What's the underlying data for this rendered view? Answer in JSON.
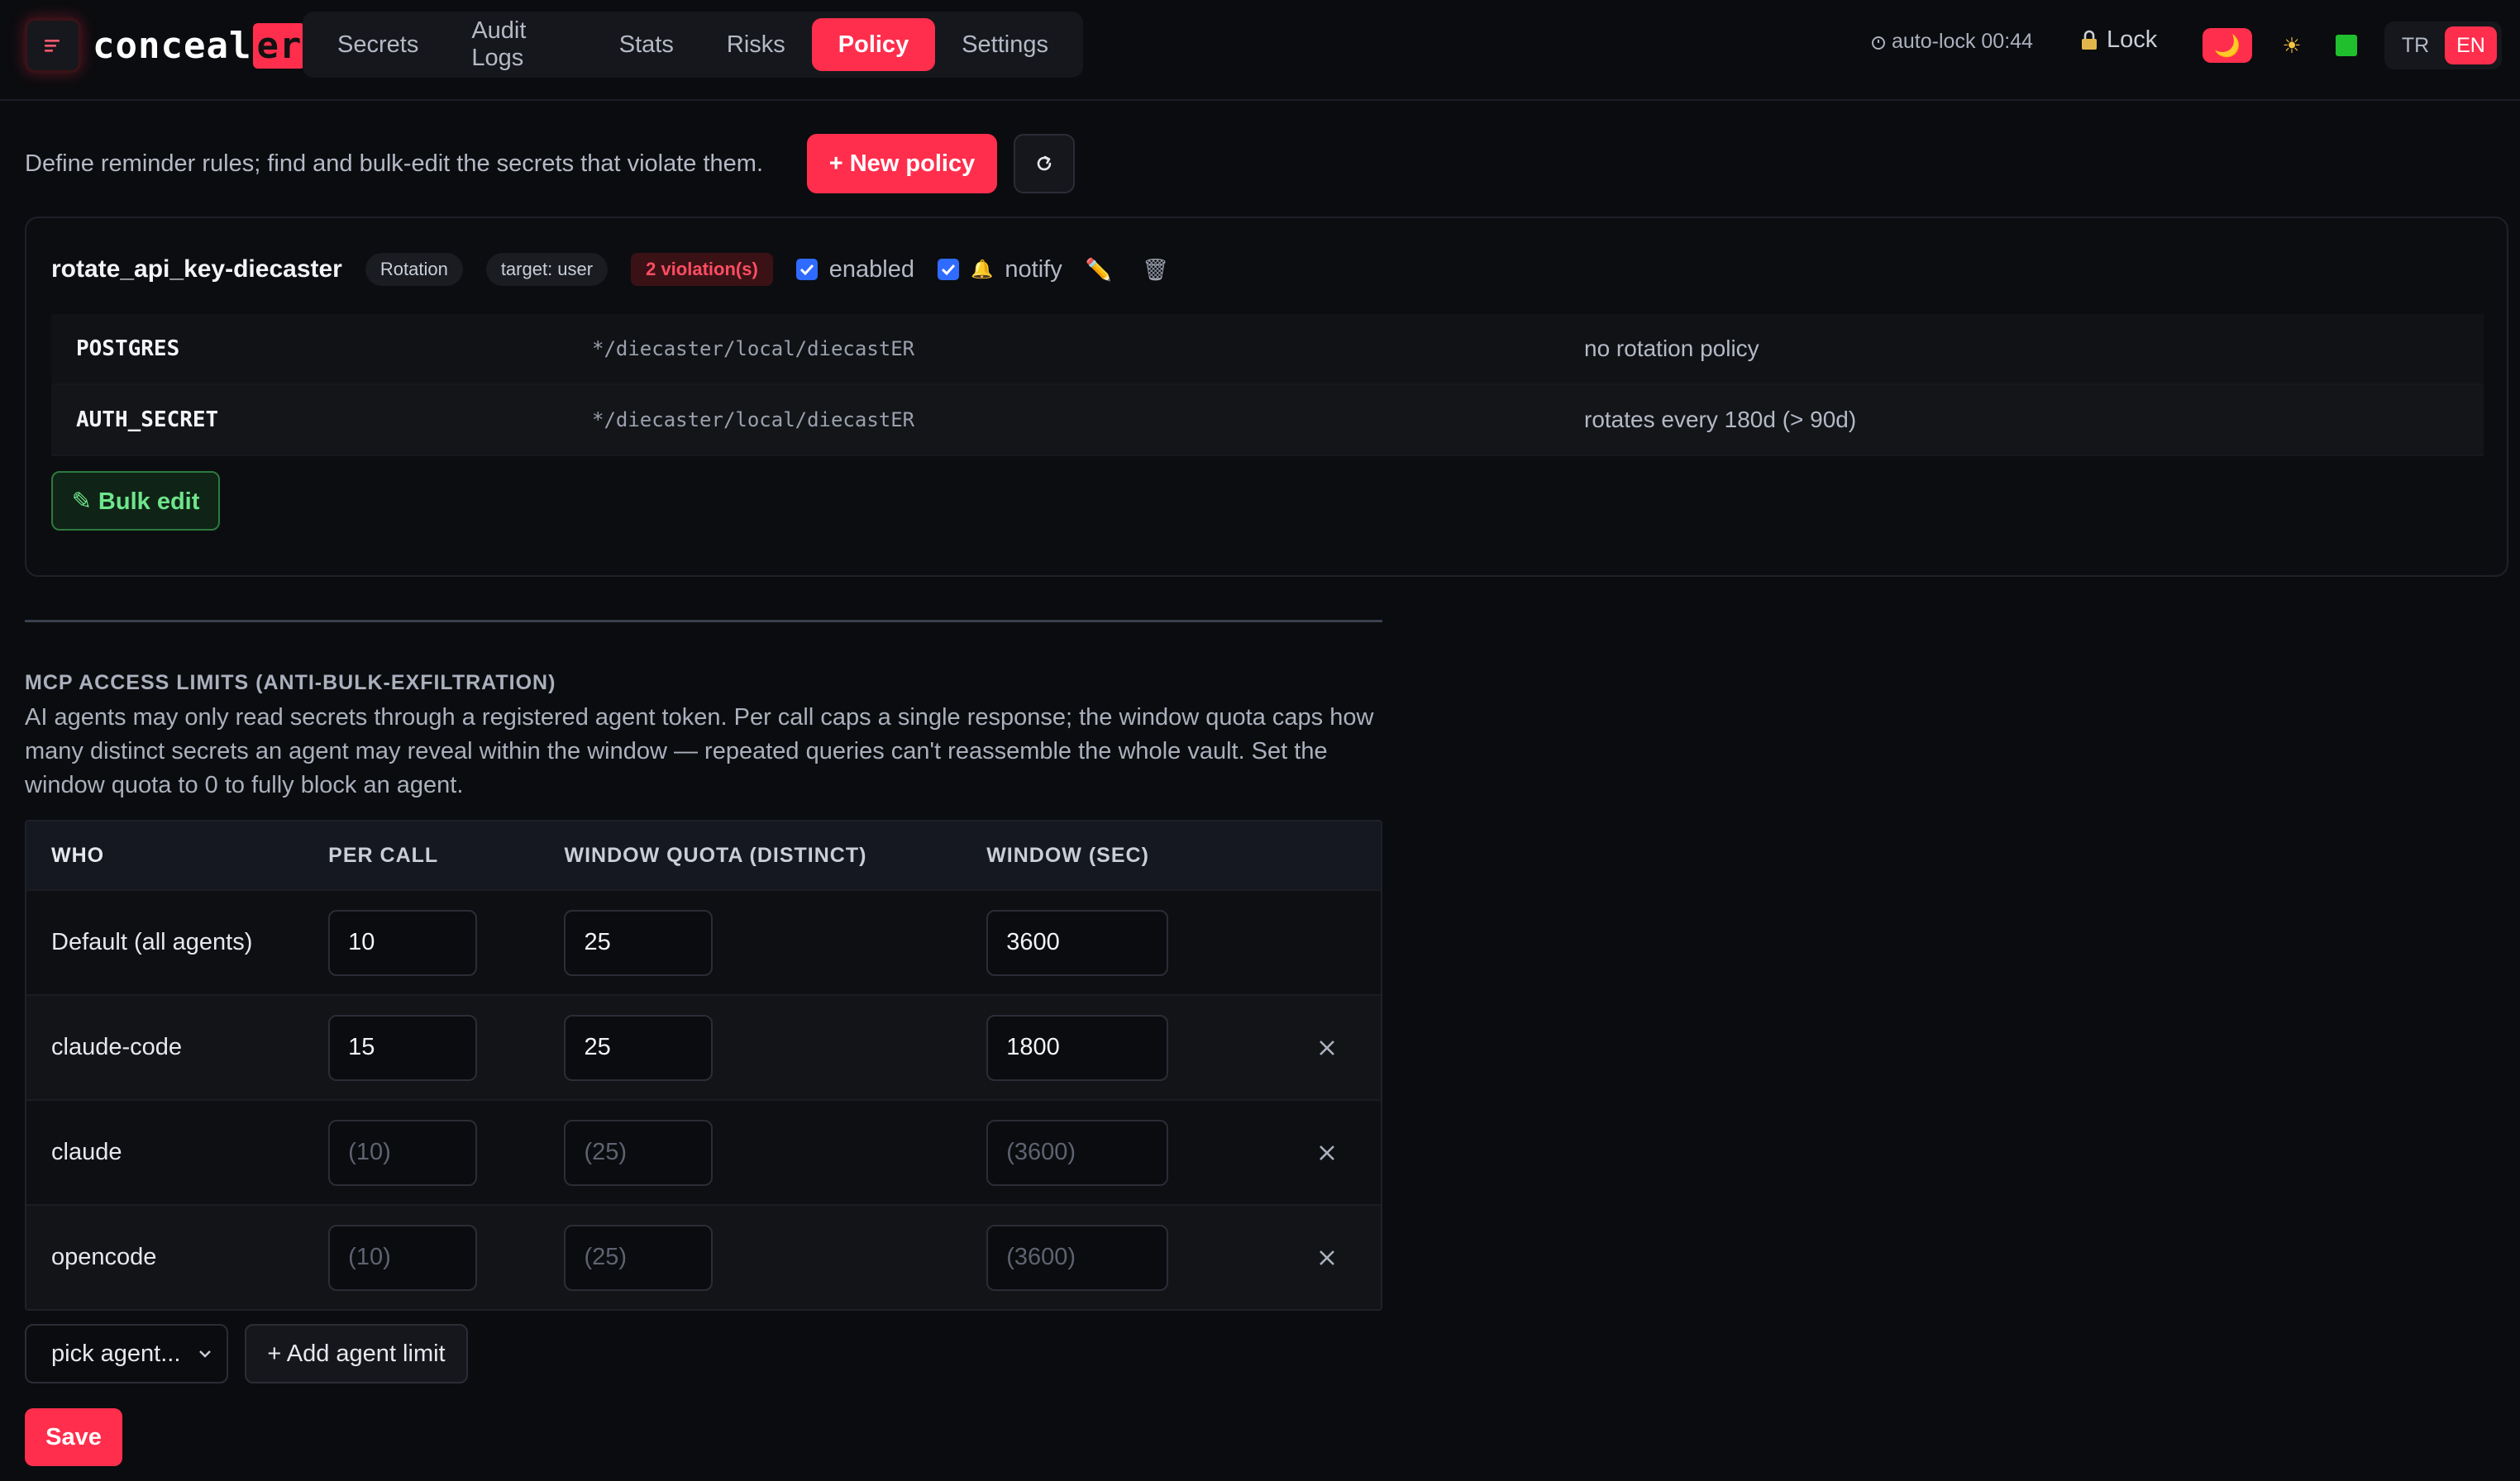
{
  "app": {
    "logo_prefix": "conceal",
    "logo_highlight": "er"
  },
  "nav": {
    "tabs": [
      "Secrets",
      "Audit Logs",
      "Stats",
      "Risks",
      "Policy",
      "Settings"
    ],
    "active": "Policy"
  },
  "header": {
    "autolock": "auto-lock 00:44",
    "lock_label": "Lock",
    "lang_tr": "TR",
    "lang_en": "EN",
    "active_lang": "EN",
    "theme_moon": "🌙",
    "theme_sun": "☀"
  },
  "intro": {
    "text": "Define reminder rules; find and bulk-edit the secrets that violate them.",
    "new_policy_label": "+ New policy"
  },
  "policy": {
    "name": "rotate_api_key-diecaster",
    "type_chip": "Rotation",
    "target_chip": "target: user",
    "violations_chip": "2 violation(s)",
    "enabled_label": "enabled",
    "notify_label": "notify",
    "bell": "🔔",
    "edit_icon": "✏️",
    "delete_icon": "🗑",
    "rows": [
      {
        "name": "POSTGRES",
        "path": "*/diecaster/local/diecastER",
        "reason": "no rotation policy"
      },
      {
        "name": "AUTH_SECRET",
        "path": "*/diecaster/local/diecastER",
        "reason": "rotates every 180d (> 90d)"
      }
    ],
    "bulk_edit_label": "✎ Bulk edit"
  },
  "mcp": {
    "title": "MCP ACCESS LIMITS (ANTI-BULK-EXFILTRATION)",
    "description": "AI agents may only read secrets through a registered agent token. Per call caps a single response; the window quota caps how many distinct secrets an agent may reveal within the window — repeated queries can't reassemble the whole vault. Set the window quota to 0 to fully block an agent.",
    "columns": {
      "who": "WHO",
      "per_call": "PER CALL",
      "window_quota": "WINDOW QUOTA (DISTINCT)",
      "window_sec": "WINDOW (SEC)"
    },
    "rows": [
      {
        "who": "Default (all agents)",
        "per_call": "10",
        "per_call_ph": "",
        "quota": "25",
        "quota_ph": "",
        "sec": "3600",
        "sec_ph": "",
        "removable": false
      },
      {
        "who": "claude-code",
        "per_call": "15",
        "per_call_ph": "",
        "quota": "25",
        "quota_ph": "",
        "sec": "1800",
        "sec_ph": "",
        "removable": true
      },
      {
        "who": "claude",
        "per_call": "",
        "per_call_ph": "(10)",
        "quota": "",
        "quota_ph": "(25)",
        "sec": "",
        "sec_ph": "(3600)",
        "removable": true
      },
      {
        "who": "opencode",
        "per_call": "",
        "per_call_ph": "(10)",
        "quota": "",
        "quota_ph": "(25)",
        "sec": "",
        "sec_ph": "(3600)",
        "removable": true
      }
    ],
    "pick_agent_label": "pick agent...",
    "add_limit_label": "+ Add agent limit",
    "save_label": "Save"
  },
  "colors": {
    "accent": "#ff2e4d",
    "success": "#6fe58c",
    "checkbox": "#2f6bff"
  }
}
